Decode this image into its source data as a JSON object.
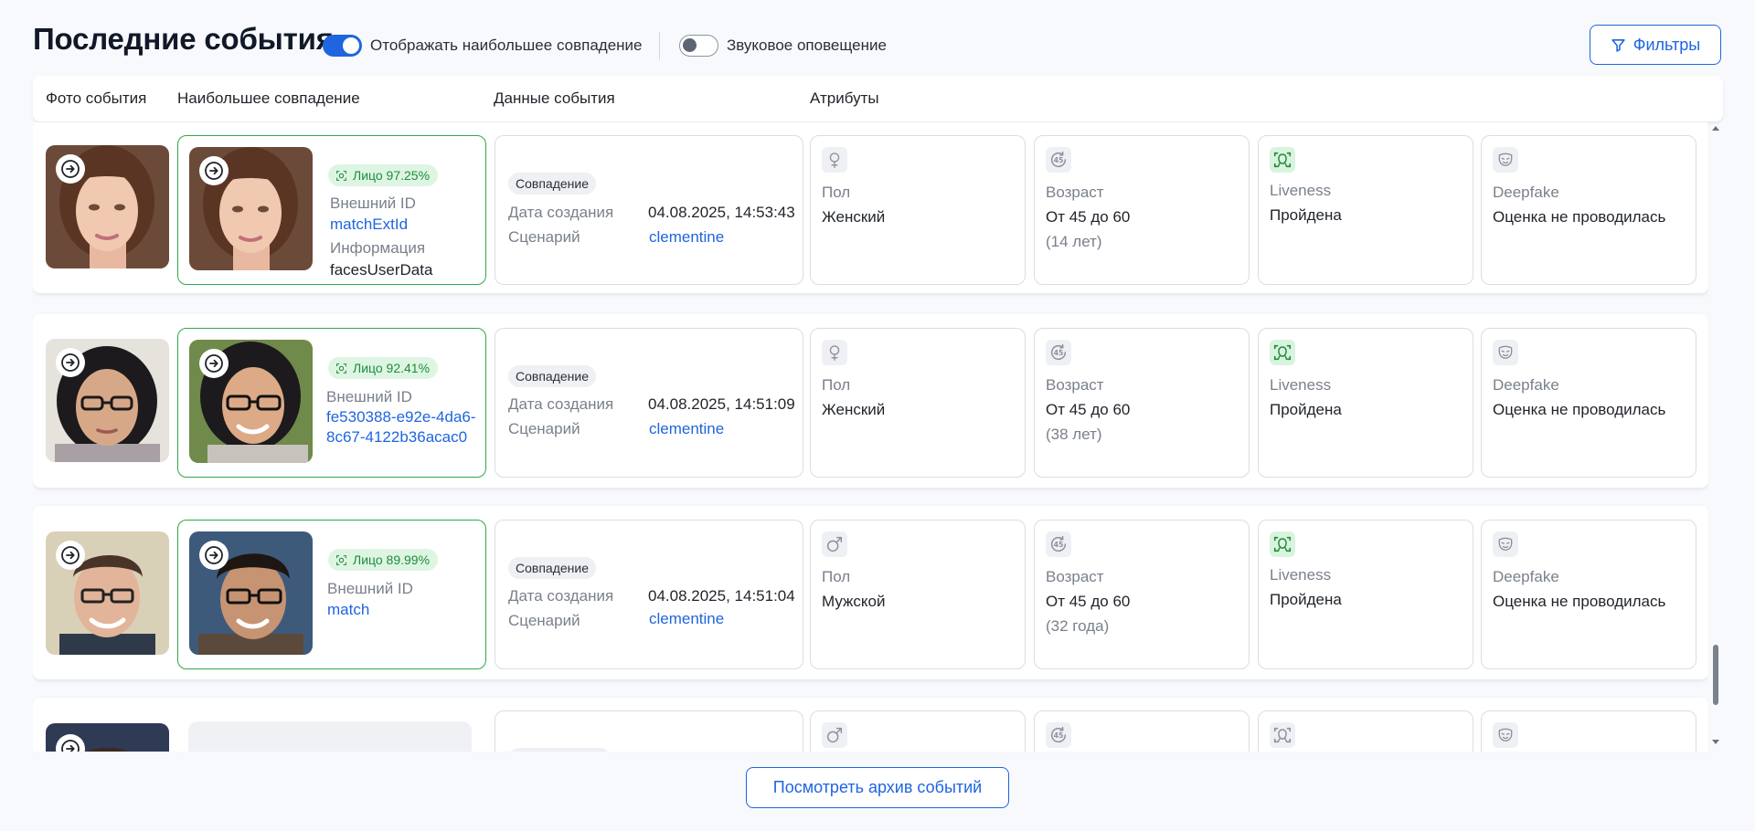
{
  "page": {
    "title": "Последние события",
    "toggle_best_match": {
      "label": "Отображать наибольшее совпадение",
      "on": true
    },
    "toggle_sound": {
      "label": "Звуковое оповещение",
      "on": false
    },
    "filters_label": "Фильтры",
    "archive_label": "Посмотреть архив событий"
  },
  "columns": {
    "photo": "Фото события",
    "best_match": "Наибольшее совпадение",
    "event_data": "Данные события",
    "attributes": "Атрибуты"
  },
  "labels": {
    "external_id": "Внешний ID",
    "info": "Информация",
    "badge": "Совпадение",
    "created": "Дата создания",
    "scenario": "Сценарий",
    "gender": "Пол",
    "age": "Возраст",
    "liveness": "Liveness",
    "deepfake": "Deepfake"
  },
  "events": [
    {
      "match_pill": "Лицо 97.25%",
      "external_id_value": "matchExtId",
      "info_value": "facesUserData",
      "created_value": "04.08.2025, 14:53:43",
      "scenario_value": "clementine",
      "gender_value": "Женский",
      "gender_icon": "female-icon",
      "age_value": "От 45 до 60",
      "age_sub": "(14 лет)",
      "liveness_value": "Пройдена",
      "deepfake_value": "Оценка не проводилась"
    },
    {
      "match_pill": "Лицо 92.41%",
      "external_id_value": "fe530388-e92e-4da6-8c67-4122b36acac0",
      "created_value": "04.08.2025, 14:51:09",
      "scenario_value": "clementine",
      "gender_value": "Женский",
      "gender_icon": "female-icon",
      "age_value": "От 45 до 60",
      "age_sub": "(38 лет)",
      "liveness_value": "Пройдена",
      "deepfake_value": "Оценка не проводилась"
    },
    {
      "match_pill": "Лицо 89.99%",
      "external_id_value": "match",
      "created_value": "04.08.2025, 14:51:04",
      "scenario_value": "clementine",
      "gender_value": "Мужской",
      "gender_icon": "male-icon",
      "age_value": "От 45 до 60",
      "age_sub": "(32 года)",
      "liveness_value": "Пройдена",
      "deepfake_value": "Оценка не проводилась"
    }
  ],
  "colors": {
    "accent": "#1f65e0",
    "match_border": "#2fa84a",
    "pill_bg": "#def5e3",
    "pill_text": "#1e8d3a"
  }
}
